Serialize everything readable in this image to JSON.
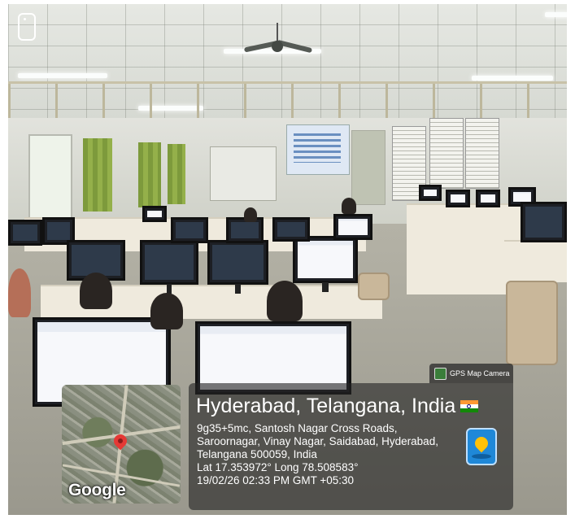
{
  "overlay": {
    "app_label": "GPS Map Camera",
    "title": "Hyderabad, Telangana, India",
    "address_lines": [
      "9g35+5mc, Santosh Nagar Cross Roads,",
      "Saroornagar, Vinay Nagar, Saidabad, Hyderabad,",
      "Telangana 500059, India"
    ],
    "coordinates": "Lat 17.353972° Long 78.508583°",
    "timestamp": "19/02/26 02:33 PM GMT +05:30",
    "map_logo": "Google"
  },
  "icons": [
    "phone-frame-icon",
    "camera-app-icon",
    "india-flag-icon",
    "map-pin-icon",
    "location-camera-icon"
  ]
}
